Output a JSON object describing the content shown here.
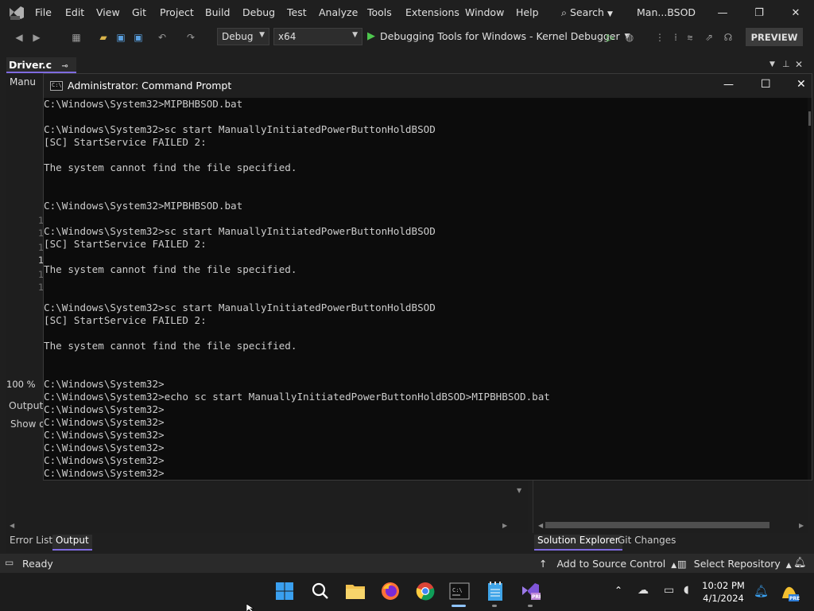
{
  "vs": {
    "menus": [
      "File",
      "Edit",
      "View",
      "Git",
      "Project",
      "Build",
      "Debug",
      "Test",
      "Analyze",
      "Tools",
      "Extensions",
      "Window",
      "Help"
    ],
    "search_label": "Search",
    "window_title": "Man...BSOD",
    "toolbar": {
      "config": "Debug",
      "platform": "x64",
      "debug_target": "Debugging Tools for Windows - Kernel Debugger",
      "preview_label": "PREVIEW"
    },
    "doc_tab": "Driver.c",
    "manu_label": "Manu",
    "line_numbers": [
      "1",
      "1",
      "1",
      "1",
      "1",
      "1"
    ],
    "zoom": "100 %",
    "output_label": "Output",
    "show_output_label": "Show o",
    "bottom_tabs": [
      "Error List",
      "Output",
      "Solution Explorer",
      "Git Changes"
    ],
    "status": {
      "ready": "Ready",
      "source_control": "Add to Source Control",
      "repository": "Select Repository"
    }
  },
  "cmd": {
    "title": "Administrator: Command Prompt",
    "lines": [
      "C:\\Windows\\System32>MIPBHBSOD.bat",
      "",
      "C:\\Windows\\System32>sc start ManuallyInitiatedPowerButtonHoldBSOD",
      "[SC] StartService FAILED 2:",
      "",
      "The system cannot find the file specified.",
      "",
      "",
      "C:\\Windows\\System32>MIPBHBSOD.bat",
      "",
      "C:\\Windows\\System32>sc start ManuallyInitiatedPowerButtonHoldBSOD",
      "[SC] StartService FAILED 2:",
      "",
      "The system cannot find the file specified.",
      "",
      "",
      "C:\\Windows\\System32>sc start ManuallyInitiatedPowerButtonHoldBSOD",
      "[SC] StartService FAILED 2:",
      "",
      "The system cannot find the file specified.",
      "",
      "",
      "C:\\Windows\\System32>",
      "C:\\Windows\\System32>echo sc start ManuallyInitiatedPowerButtonHoldBSOD>MIPBHBSOD.bat",
      "C:\\Windows\\System32>",
      "C:\\Windows\\System32>",
      "C:\\Windows\\System32>",
      "C:\\Windows\\System32>",
      "C:\\Windows\\System32>",
      "C:\\Windows\\System32>"
    ]
  },
  "taskbar": {
    "apps": [
      "windows-start-icon",
      "search-icon",
      "file-explorer-icon",
      "firefox-icon",
      "chrome-icon",
      "terminal-icon",
      "notepad-icon",
      "visual-studio-icon"
    ],
    "time": "10:02 PM",
    "date": "4/1/2024"
  },
  "colors": {
    "accent": "#7f6be0",
    "console_bg": "#0c0c0c",
    "console_text": "#cccccc",
    "taskbar_bg": "#1c1c1c"
  }
}
